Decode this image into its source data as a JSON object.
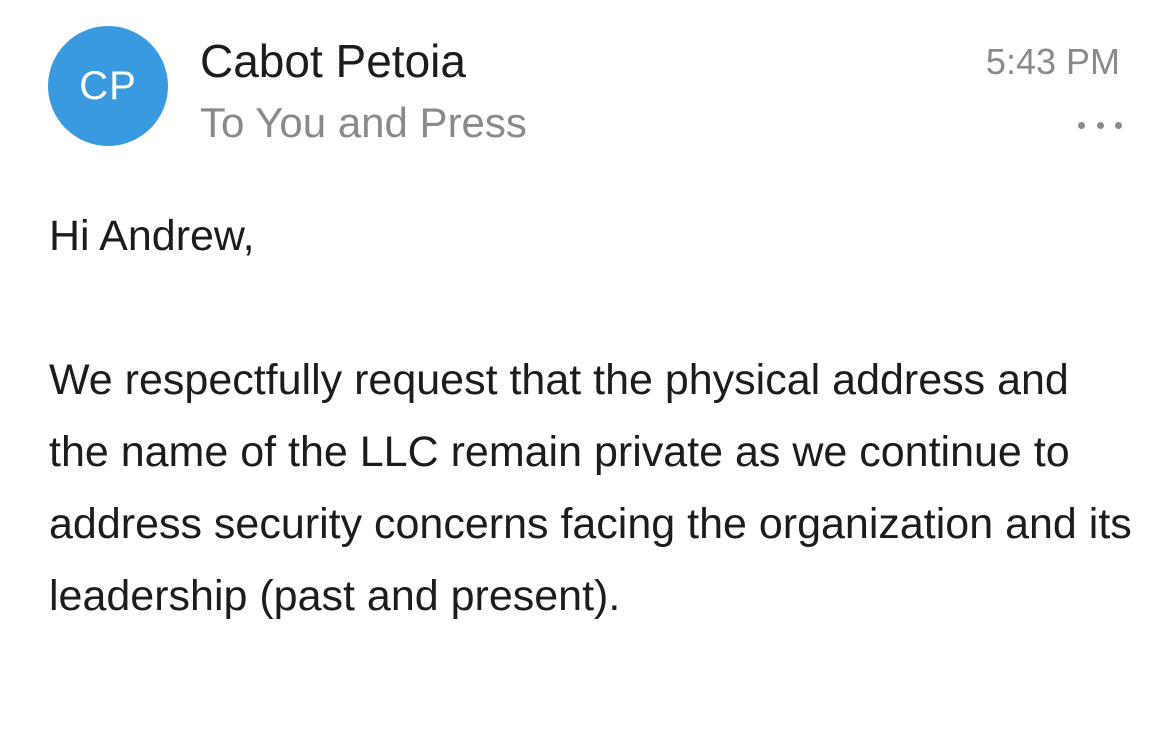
{
  "email": {
    "sender": {
      "initials": "CP",
      "name": "Cabot Petoia",
      "avatar_color": "#3a9ae0"
    },
    "recipients": "To You and Press",
    "time": "5:43 PM",
    "more_icon": "ellipsis-icon",
    "body": {
      "greeting": "Hi Andrew,",
      "paragraph": "We respectfully request that the physical address and the name of the LLC remain private as we continue to address security concerns facing the organization and its leadership (past and present)."
    }
  }
}
